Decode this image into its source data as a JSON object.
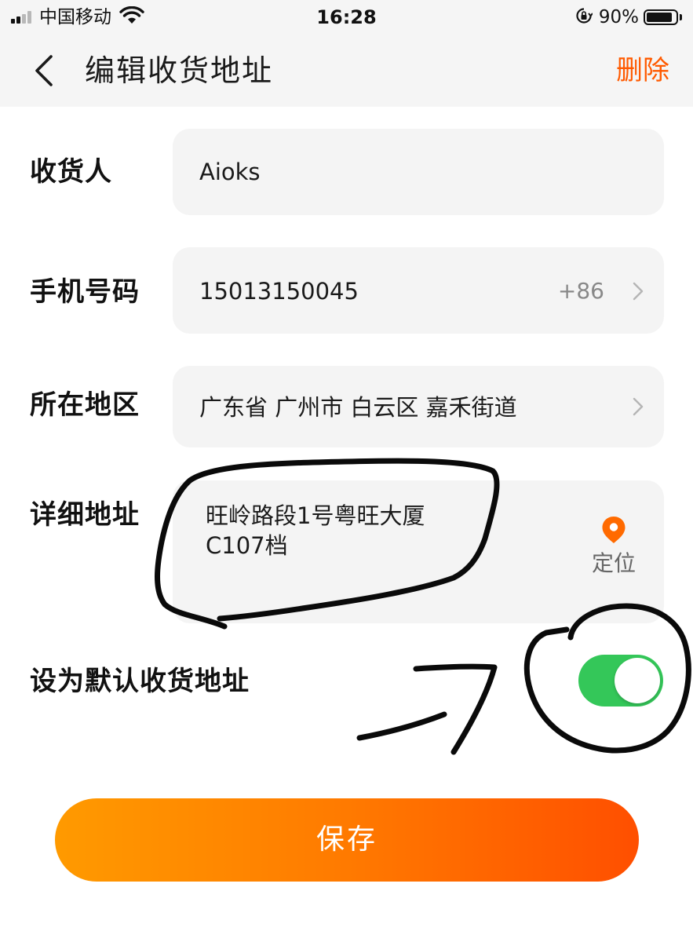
{
  "status_bar": {
    "carrier": "中国移动",
    "time": "16:28",
    "battery_percent": "90%",
    "battery_level": 0.9,
    "signal_bars_filled": 2,
    "signal_bars_total": 4,
    "icons": [
      "signal-icon",
      "wifi-icon",
      "orientation-lock-icon",
      "battery-icon"
    ]
  },
  "nav": {
    "back_icon": "chevron-left-icon",
    "title": "编辑收货地址",
    "delete_label": "删除"
  },
  "form": {
    "recipient": {
      "label": "收货人",
      "value": "Aioks"
    },
    "phone": {
      "label": "手机号码",
      "value": "15013150045",
      "country_code": "+86"
    },
    "region": {
      "label": "所在地区",
      "value": "广东省 广州市 白云区 嘉禾街道"
    },
    "address": {
      "label": "详细地址",
      "line1": "旺岭路段1号粤旺大厦",
      "line2": "C107档",
      "locate_label": "定位",
      "locate_icon": "location-pin-icon"
    },
    "default_address": {
      "label": "设为默认收货地址",
      "enabled": true
    }
  },
  "save_label": "保存",
  "colors": {
    "accent": "#ff5a00",
    "toggle_on": "#34c759",
    "save_gradient_start": "#ff9a00",
    "save_gradient_end": "#ff4f00",
    "field_bg": "#f4f4f4",
    "header_bg": "#f5f5f5"
  }
}
